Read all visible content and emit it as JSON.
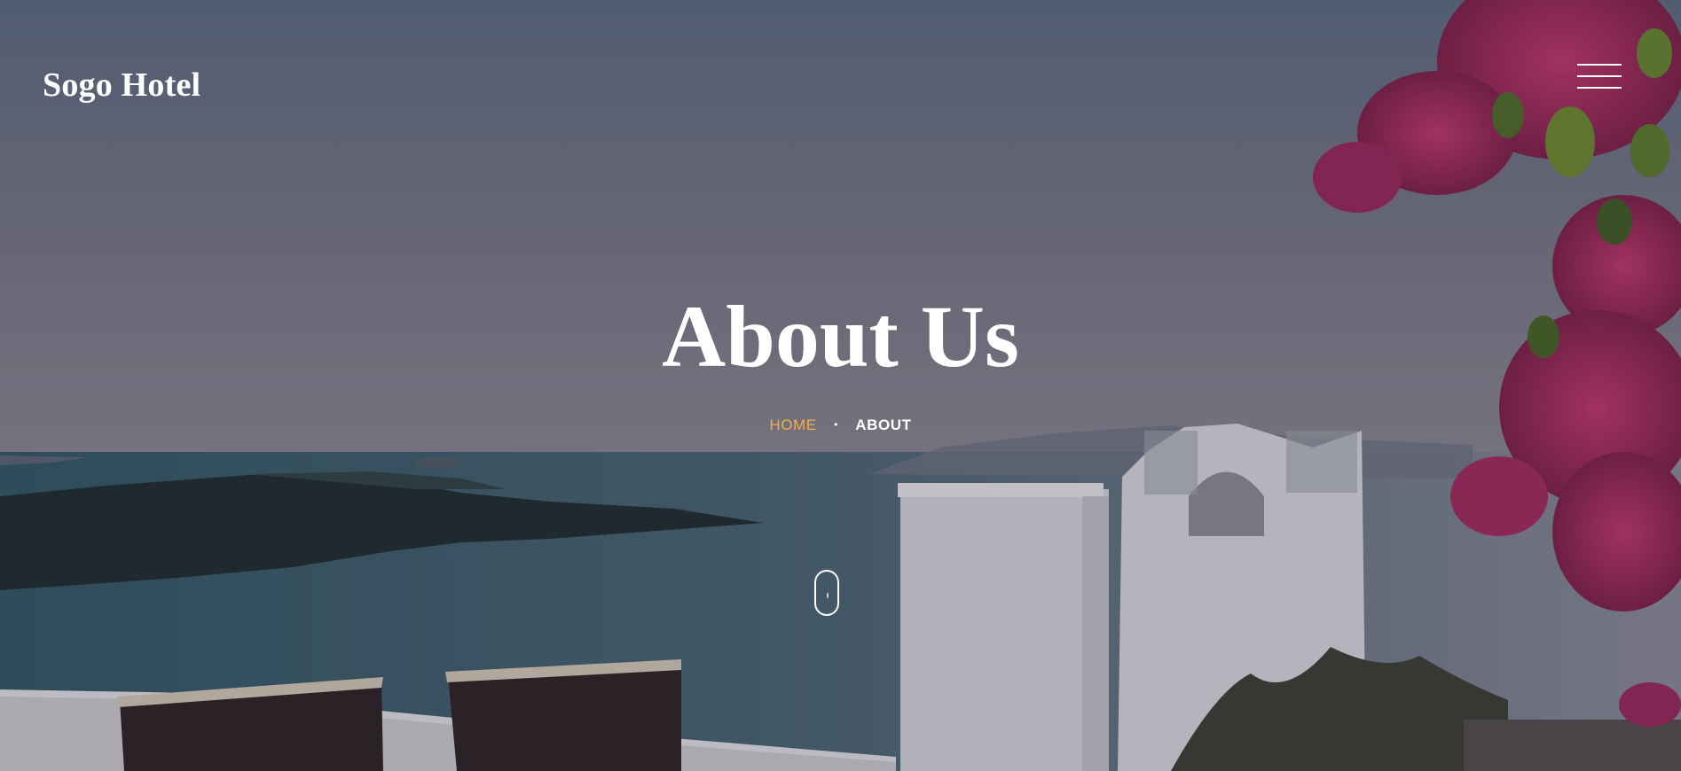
{
  "header": {
    "brand": "Sogo Hotel",
    "menu_icon": "hamburger-menu-icon"
  },
  "hero": {
    "title": "About Us",
    "background": "sea-view-terrace-with-bougainvillea",
    "overlay_color": "#2d2f45"
  },
  "breadcrumb": {
    "home_label": "HOME",
    "separator": "•",
    "current_label": "ABOUT",
    "home_color": "#f0ad4e"
  },
  "scroll_indicator": {
    "icon": "mouse-scroll-icon"
  }
}
